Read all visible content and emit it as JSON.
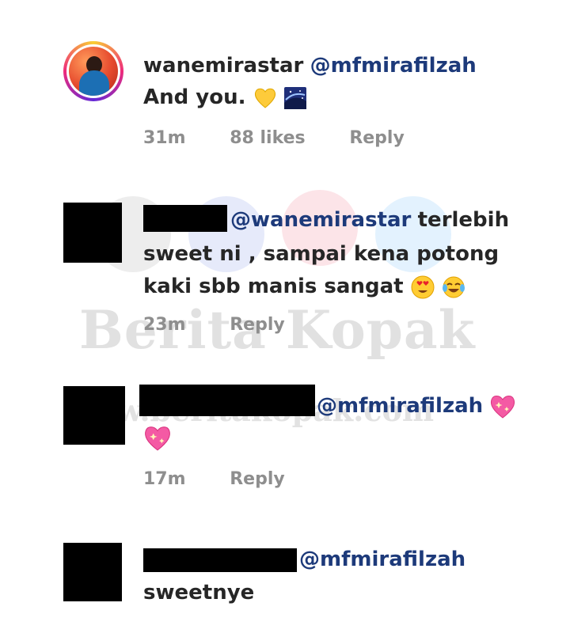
{
  "watermark": {
    "title": "Berita Kopak",
    "url": "www.beritakopak.com"
  },
  "comments": [
    {
      "username": "wanemirastar",
      "mention": "@mfmirafilzah",
      "text": "And you.",
      "time": "31m",
      "likes": "88 likes",
      "reply": "Reply",
      "avatar_icon": "profile-photo"
    },
    {
      "mention": "@wanemirastar",
      "text_line1": "terlebih",
      "text_line2": "sweet ni , sampai kena potong",
      "text_line3": "kaki sbb manis sangat",
      "time": "23m",
      "reply": "Reply"
    },
    {
      "mention": "@mfmirafilzah",
      "time": "17m",
      "reply": "Reply"
    },
    {
      "mention": "@mfmirafilzah",
      "text": "sweetnye"
    }
  ],
  "emoji_icons": [
    "yellow-heart-icon",
    "night-sky-icon",
    "heart-eyes-icon",
    "tears-of-joy-icon",
    "sparkling-heart-icon"
  ]
}
